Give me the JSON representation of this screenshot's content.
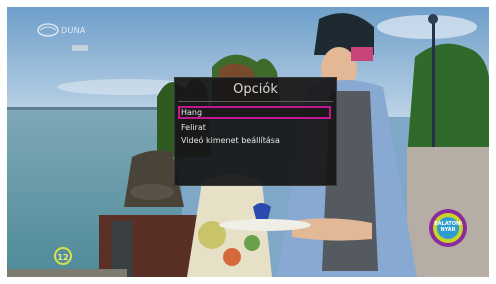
{
  "options_menu": {
    "title": "Opciók",
    "items": [
      {
        "label": "Hang",
        "selected": true
      },
      {
        "label": "Felirat",
        "selected": false
      },
      {
        "label": "Videó kimenet beállítása",
        "selected": false
      }
    ]
  },
  "channel_logo": {
    "icon": "duna-channel-logo-icon",
    "text": "DUNA"
  },
  "age_rating": {
    "icon": "age-rating-badge-icon",
    "value": "12"
  },
  "program_promo": {
    "icon": "program-promo-badge-icon",
    "text": "BALATONI NYÁR"
  },
  "colors": {
    "menu_highlight": "#c01890",
    "menu_background": "#161616"
  }
}
